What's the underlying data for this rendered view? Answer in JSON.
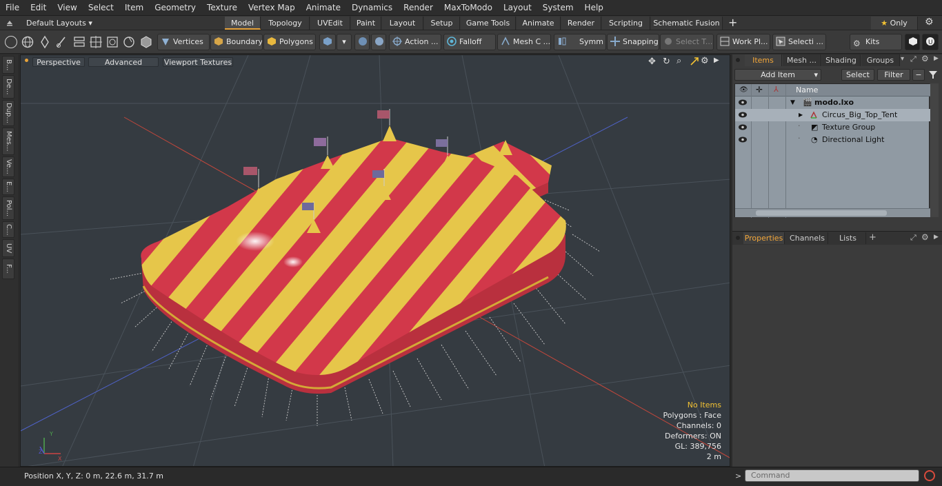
{
  "menu": [
    "File",
    "Edit",
    "View",
    "Select",
    "Item",
    "Geometry",
    "Texture",
    "Vertex Map",
    "Animate",
    "Dynamics",
    "Render",
    "MaxToModo",
    "Layout",
    "System",
    "Help"
  ],
  "layout_selector": "Default Layouts",
  "tabs": [
    "Model",
    "Topology",
    "UVEdit",
    "Paint",
    "Layout",
    "Setup",
    "Game Tools",
    "Animate",
    "Render",
    "Scripting",
    "Schematic Fusion"
  ],
  "active_tab": "Model",
  "only_label": "Only",
  "toolbar": {
    "vertices": "Vertices",
    "boundary": "Boundary",
    "polygons": "Polygons",
    "action": "Action ...",
    "falloff": "Falloff",
    "mesh": "Mesh C ...",
    "symm": "Symm ...",
    "snapping": "Snapping",
    "select_t": "Select T...",
    "work_pl": "Work Pl...",
    "selecti": "Selecti ...",
    "kits": "Kits"
  },
  "left_strip": [
    "B...",
    "De...",
    "Dup...",
    "Mes...",
    "Ve...",
    "E...",
    "Pol...",
    "C...",
    "UV",
    "F..."
  ],
  "viewport": {
    "perspective": "Perspective",
    "advanced": "Advanced",
    "textures": "Viewport Textures",
    "stats": {
      "items": "No Items",
      "polygons": "Polygons : Face",
      "channels": "Channels: 0",
      "deformers": "Deformers: ON",
      "gl": "GL: 389,756",
      "scale": "2 m"
    }
  },
  "status": {
    "position": "Position X, Y, Z:   0 m, 22.6 m, 31.7 m"
  },
  "right": {
    "tabs_top": [
      "Items",
      "Mesh ...",
      "Shading",
      "Groups"
    ],
    "add_item": "Add Item",
    "select": "Select",
    "filter": "Filter",
    "name_col": "Name",
    "tree": [
      {
        "label": "modo.lxo",
        "bold": true
      },
      {
        "label": "Circus_Big_Top_Tent"
      },
      {
        "label": "Texture Group"
      },
      {
        "label": "Directional Light"
      }
    ],
    "tabs_bottom": [
      "Properties",
      "Channels",
      "Lists"
    ]
  },
  "command_placeholder": "Command",
  "colors": {
    "accent": "#e8a33a",
    "tent_red": "#d2384a",
    "tent_yellow": "#e6c64a"
  }
}
